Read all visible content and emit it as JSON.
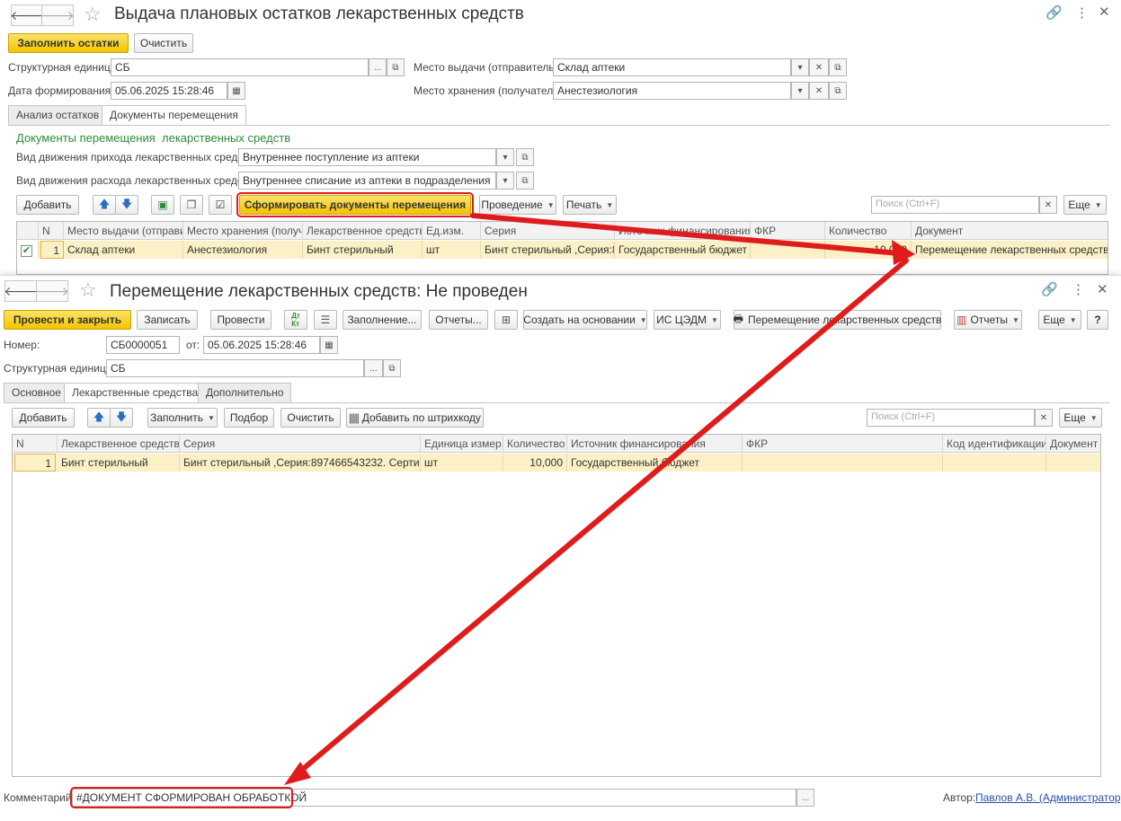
{
  "window1": {
    "title": "Выдача плановых остатков лекарственных средств",
    "fill_button": "Заполнить остатки",
    "clear_button": "Очистить",
    "struct_unit_label": "Структурная единица:",
    "struct_unit_value": "СБ",
    "date_label": "Дата формирования:",
    "date_value": "05.06.2025 15:28:46",
    "issue_place_label": "Место выдачи (отправитель):",
    "issue_place_value": "Склад аптеки",
    "storage_place_label": "Место хранения (получатель):",
    "storage_place_value": "Анестезиология",
    "tabs": [
      "Анализ остатков",
      "Документы перемещения"
    ],
    "section_title": "Документы перемещения  лекарственных средств",
    "income_label": "Вид движения прихода лекарственных средств:",
    "income_value": "Внутреннее поступление из аптеки",
    "expense_label": "Вид движения расхода лекарственных средств:",
    "expense_value": "Внутреннее списание из аптеки в подразделения",
    "add_button": "Добавить",
    "form_docs_button": "Сформировать документы перемещения",
    "posting_button": "Проведение",
    "print_button": "Печать",
    "search_placeholder": "Поиск (Ctrl+F)",
    "more_button": "Еще",
    "columns": [
      "N",
      "Место выдачи (отправи...",
      "Место хранения (получ...",
      "Лекарственное средств...",
      "Ед.изм.",
      "Серия",
      "Источник финансирования",
      "ФКР",
      "Количество",
      "Документ"
    ],
    "row": {
      "n": "1",
      "issue_place": "Склад аптеки",
      "storage_place": "Анестезиология",
      "drug": "Бинт стерильный",
      "unit": "шт",
      "series": "Бинт стерильный ,Серия:8...",
      "funding": "Государственный бюджет",
      "fkr": "",
      "quantity": "10,000",
      "document": "Перемещение лекарственных средств СБ"
    }
  },
  "window2": {
    "title": "Перемещение лекарственных средств: Не проведен",
    "post_close_button": "Провести и закрыть",
    "save_button": "Записать",
    "post_button": "Провести",
    "fill_button": "Заполнение...",
    "reports_button": "Отчеты...",
    "create_based_button": "Создать на основании",
    "is_cedm_button": "ИС ЦЭДМ",
    "print_move_button": "Перемещение лекарственных средств",
    "reports_dd_button": "Отчеты",
    "more_button": "Еще",
    "help_button": "?",
    "number_label": "Номер:",
    "number_value": "СБ0000051",
    "from_label": "от:",
    "date_value": "05.06.2025 15:28:46",
    "struct_unit_label": "Структурная единица:",
    "struct_unit_value": "СБ",
    "tabs": [
      "Основное",
      "Лекарственные средства",
      "Дополнительно"
    ],
    "add_button": "Добавить",
    "fill_dd_button": "Заполнить",
    "select_button": "Подбор",
    "clear_button": "Очистить",
    "barcode_button": "Добавить по штрихкоду",
    "search_placeholder": "Поиск (Ctrl+F)",
    "columns": [
      "N",
      "Лекарственное средство",
      "Серия",
      "Единица измер...",
      "Количество",
      "Источник финансирования",
      "ФКР",
      "Код идентификации",
      "Документ р"
    ],
    "row": {
      "n": "1",
      "drug": "Бинт стерильный",
      "series": "Бинт стерильный ,Серия:897466543232. Сертифи...",
      "unit": "шт",
      "quantity": "10,000",
      "funding": "Государственный бюджет",
      "fkr": "",
      "code": "",
      "doc": ""
    },
    "comment_label": "Комментарий:",
    "comment_value": "#ДОКУМЕНТ СФОРМИРОВАН ОБРАБОТКОЙ",
    "author_label": "Автор:",
    "author_value": "Павлов А.В. (Администратор)"
  },
  "colors": {
    "accent_yellow": "#f3c400",
    "row_highlight": "#fbf0c6",
    "section_green": "#2e8b3a",
    "arrow_red": "#e01b1b"
  }
}
